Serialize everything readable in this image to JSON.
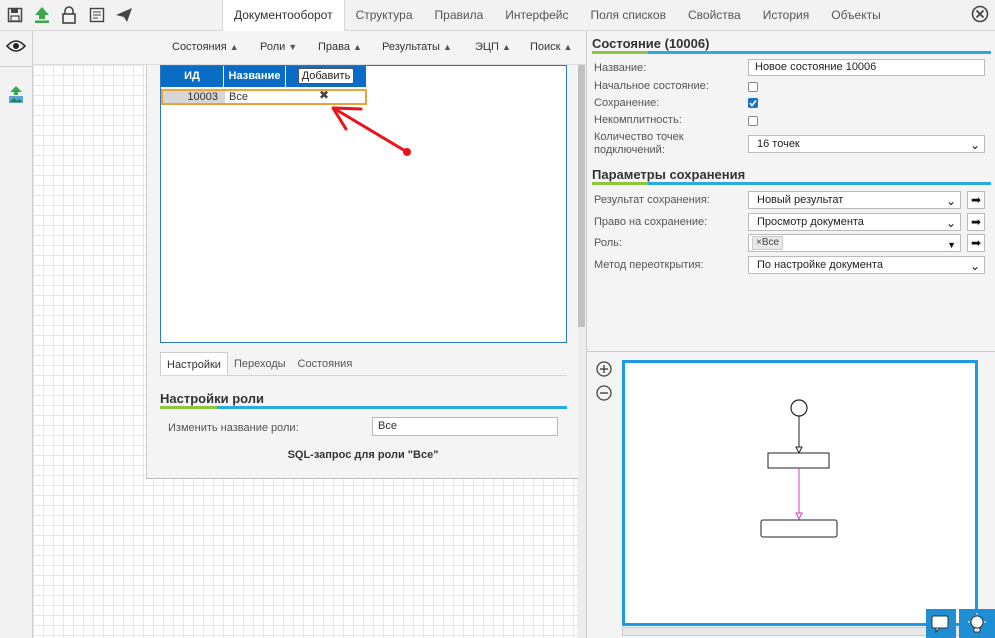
{
  "topbar": {
    "icons": [
      "save-icon",
      "upload-icon",
      "lock-icon",
      "document-icon",
      "send-icon"
    ],
    "tabs": [
      "Документооборот",
      "Структура",
      "Правила",
      "Интерфейс",
      "Поля списков",
      "Свойства",
      "История",
      "Объекты"
    ],
    "active_tab": "Документооборот",
    "close_icon": "close-circle-icon"
  },
  "toolbar": {
    "items": [
      {
        "label": "Состояния",
        "arrow": "up"
      },
      {
        "label": "Роли",
        "arrow": "down"
      },
      {
        "label": "Права",
        "arrow": "up"
      },
      {
        "label": "Результаты",
        "arrow": "up"
      },
      {
        "label": "ЭЦП",
        "arrow": "up"
      },
      {
        "label": "Поиск",
        "arrow": "up"
      }
    ]
  },
  "roles": {
    "headers": {
      "id": "ИД",
      "name": "Название"
    },
    "add_label": "Добавить",
    "rows": [
      {
        "id": "10003",
        "name": "Все"
      }
    ],
    "delete_icon": "close-x-icon"
  },
  "role_tabs": [
    "Настройки",
    "Переходы",
    "Состояния"
  ],
  "role_settings": {
    "title": "Настройки роли",
    "rename_label": "Изменить название роли:",
    "rename_value": "Все",
    "sql_caption": "SQL-запрос для роли \"Все\""
  },
  "state": {
    "title": "Состояние (10006)",
    "name_label": "Название:",
    "name_value": "Новое состояние 10006",
    "initial_label": "Начальное состояние:",
    "initial_checked": false,
    "save_label": "Сохранение:",
    "save_checked": true,
    "incomplete_label": "Некомплитность:",
    "incomplete_checked": false,
    "points_label": "Количество точек подключений:",
    "points_value": "16 точек"
  },
  "save_params": {
    "title": "Параметры сохранения",
    "result_label": "Результат сохранения:",
    "result_value": "Новый результат",
    "right_label": "Право на сохранение:",
    "right_value": "Просмотр документа",
    "role_label": "Роль:",
    "role_tag": "Все",
    "reopen_label": "Метод переоткрытия:",
    "reopen_value": "По настройке документа"
  },
  "colors": {
    "accent_blue": "#0a6cc4",
    "canvas_border": "#1e9ae0",
    "highlight_orange": "#f0a23a",
    "annotation_red": "#e8141c",
    "section_green": "#8cc63f",
    "section_blue": "#29abe2"
  }
}
